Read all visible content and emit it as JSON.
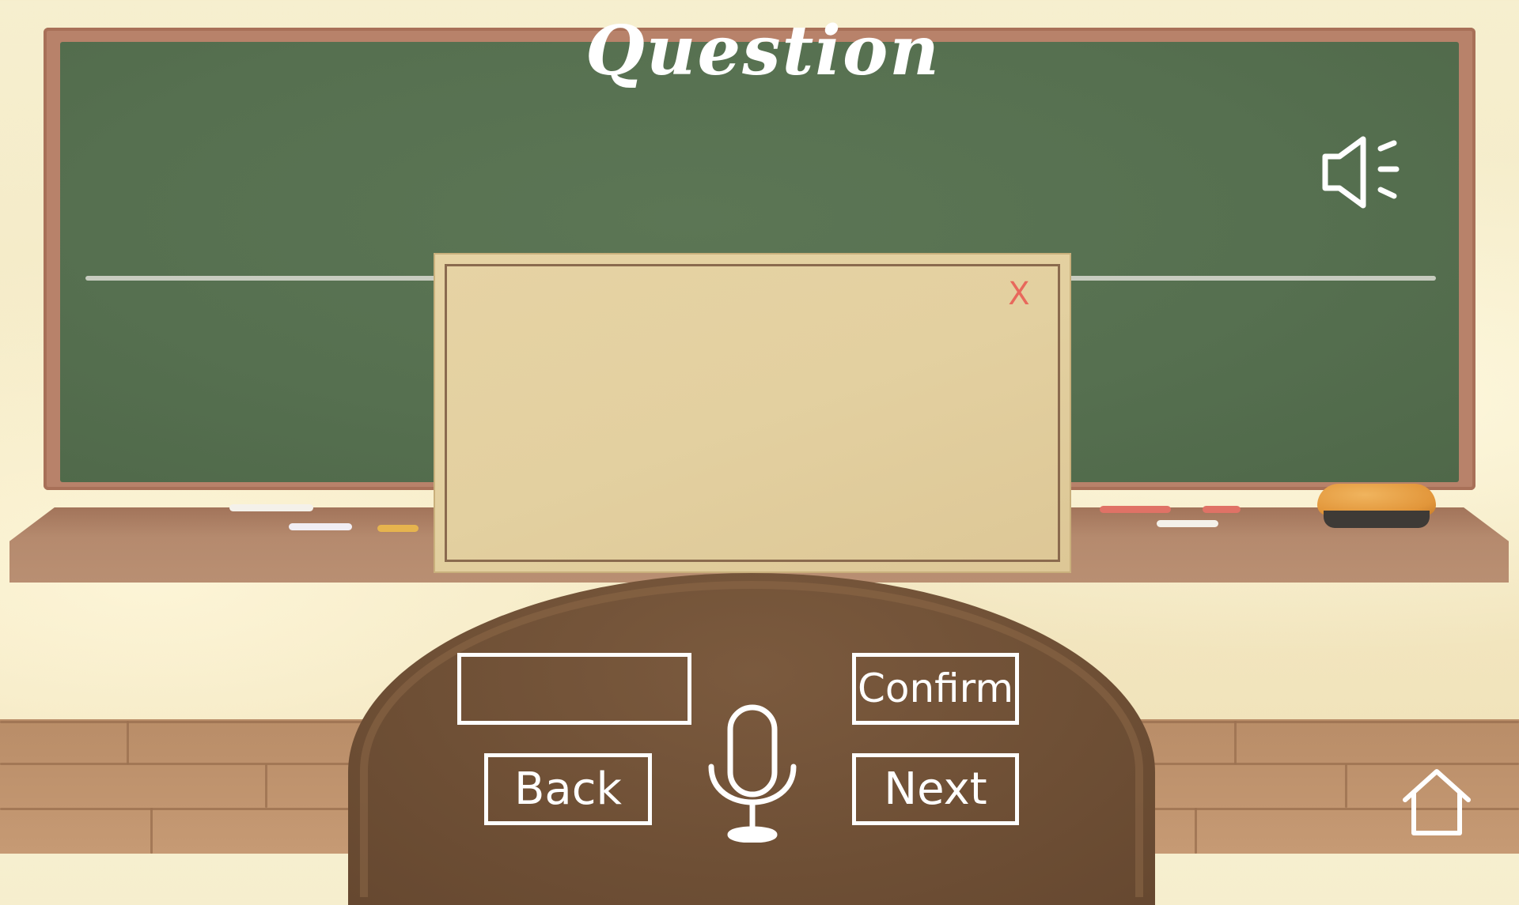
{
  "title": "Question",
  "dialog": {
    "close_label": "X",
    "content": ""
  },
  "controls": {
    "answer_value": "",
    "confirm_label": "Confirm",
    "back_label": "Back",
    "next_label": "Next"
  },
  "icons": {
    "speaker": "speaker-icon",
    "close": "close-icon",
    "mic": "microphone-icon",
    "home": "home-icon"
  },
  "colors": {
    "chalkboard": "#567050",
    "board_frame": "#b8826a",
    "dialog_paper": "#e3d0a0",
    "podium": "#6e4f35",
    "close_x": "#e8685c",
    "chalk_white": "#f4f1ea",
    "chalk_red": "#e07266",
    "chalk_yellow": "#e6b44e",
    "eraser": "#e2963a"
  }
}
